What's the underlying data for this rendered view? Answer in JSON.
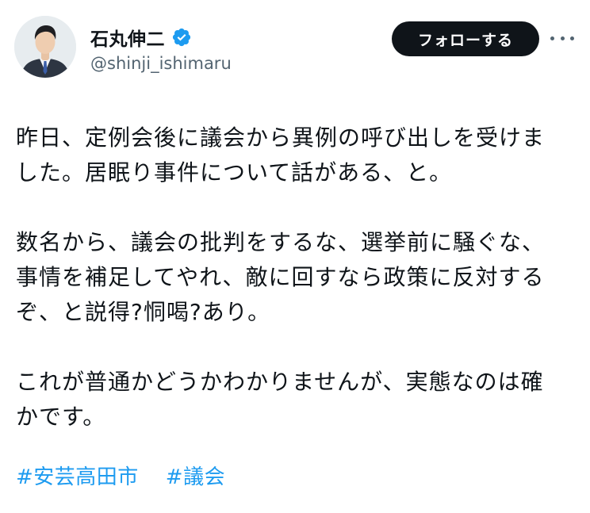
{
  "user": {
    "display_name": "石丸伸二",
    "handle": "@shinji_ishimaru",
    "verified": true,
    "avatar_icon": "profile-photo-man-in-suit"
  },
  "actions": {
    "follow_label": "フォローする",
    "more_icon": "ellipsis-icon"
  },
  "tweet": {
    "paragraphs": [
      {
        "lines": [
          "昨日、定例会後に議会から異例の呼び出しを受けま",
          "した。居眠り事件について話がある、と。"
        ]
      },
      {
        "lines": [
          "数名から、議会の批判をするな、選挙前に騒ぐな、",
          "事情を補足してやれ、敵に回すなら政策に反対する",
          "ぞ、と説得?恫喝?あり。"
        ]
      },
      {
        "lines": [
          "これが普通かどうかわかりませんが、実態なのは確",
          "かです。"
        ]
      }
    ],
    "hashtags": [
      "#安芸高田市",
      "#議会"
    ]
  },
  "colors": {
    "text": "#0f1419",
    "secondary": "#536471",
    "link": "#1d9bf0",
    "verified_badge": "#1d9bf0",
    "follow_button_bg": "#0f1419"
  }
}
